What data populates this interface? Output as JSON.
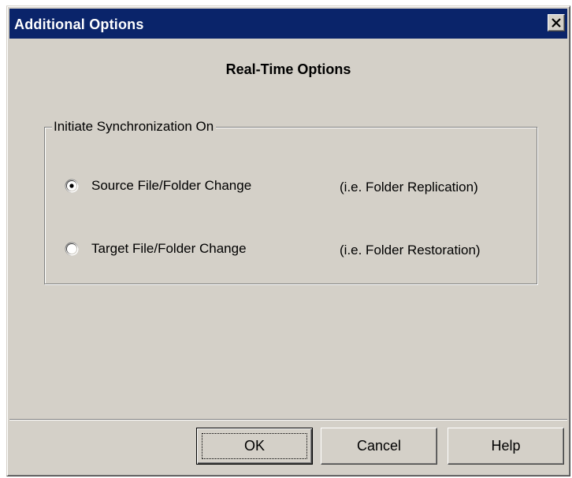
{
  "dialog": {
    "title": "Additional Options",
    "heading": "Real-Time Options"
  },
  "group": {
    "label": "Initiate Synchronization On",
    "options": [
      {
        "label": "Source File/Folder Change",
        "hint": "(i.e. Folder Replication)",
        "selected": true
      },
      {
        "label": "Target File/Folder Change",
        "hint": "(i.e. Folder Restoration)",
        "selected": false
      }
    ]
  },
  "buttons": {
    "ok": "OK",
    "cancel": "Cancel",
    "help": "Help"
  },
  "icons": {
    "close": "close-icon",
    "radio_selected": "radio-selected-icon",
    "radio_unselected": "radio-unselected-icon"
  },
  "colors": {
    "titlebar": "#0a246a",
    "face": "#d4d0c8"
  }
}
